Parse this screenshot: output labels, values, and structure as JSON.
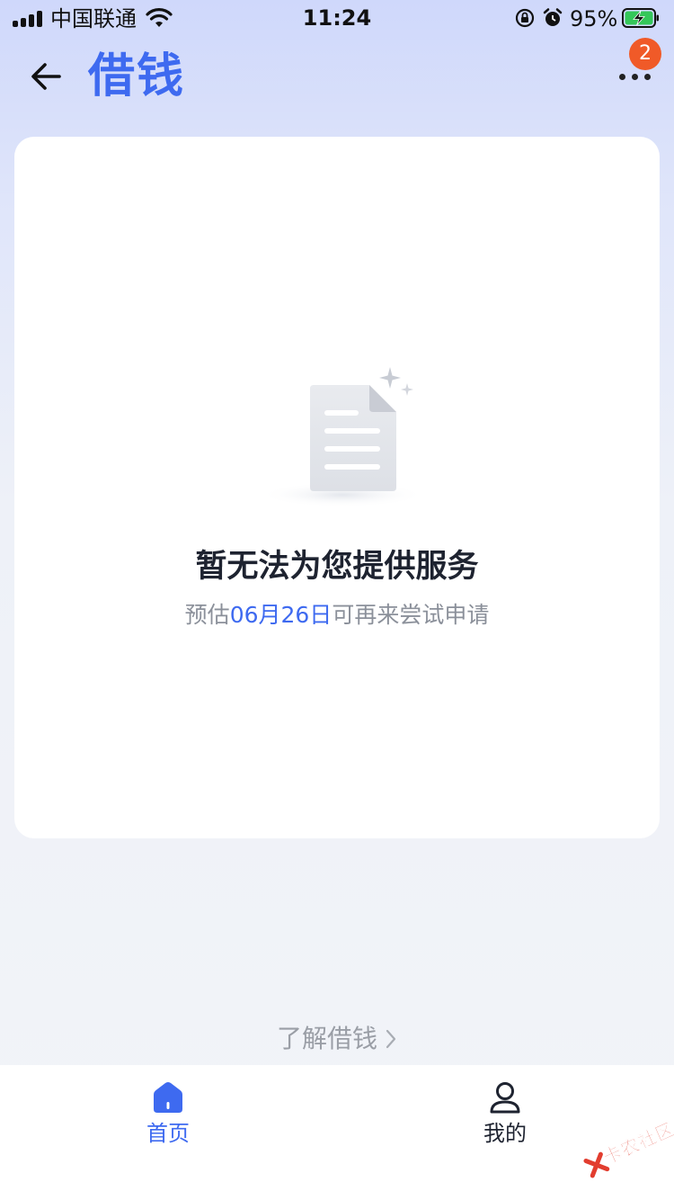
{
  "status_bar": {
    "carrier": "中国联通",
    "time": "11:24",
    "battery_percent": "95%"
  },
  "nav": {
    "title": "借钱",
    "badge_count": "2"
  },
  "empty_state": {
    "title": "暂无法为您提供服务",
    "subtitle_prefix": "预估",
    "subtitle_date": "06月26日",
    "subtitle_suffix": "可再来尝试申请"
  },
  "learn_link": {
    "label": "了解借钱"
  },
  "tabs": [
    {
      "label": "首页",
      "icon": "home-icon",
      "active": true
    },
    {
      "label": "我的",
      "icon": "user-icon",
      "active": false
    }
  ],
  "watermark": {
    "text": "卡农社区"
  },
  "colors": {
    "accent": "#3e6af0",
    "badge": "#f05a28",
    "watermark": "#e23d2f",
    "battery_fill": "#34c759"
  }
}
